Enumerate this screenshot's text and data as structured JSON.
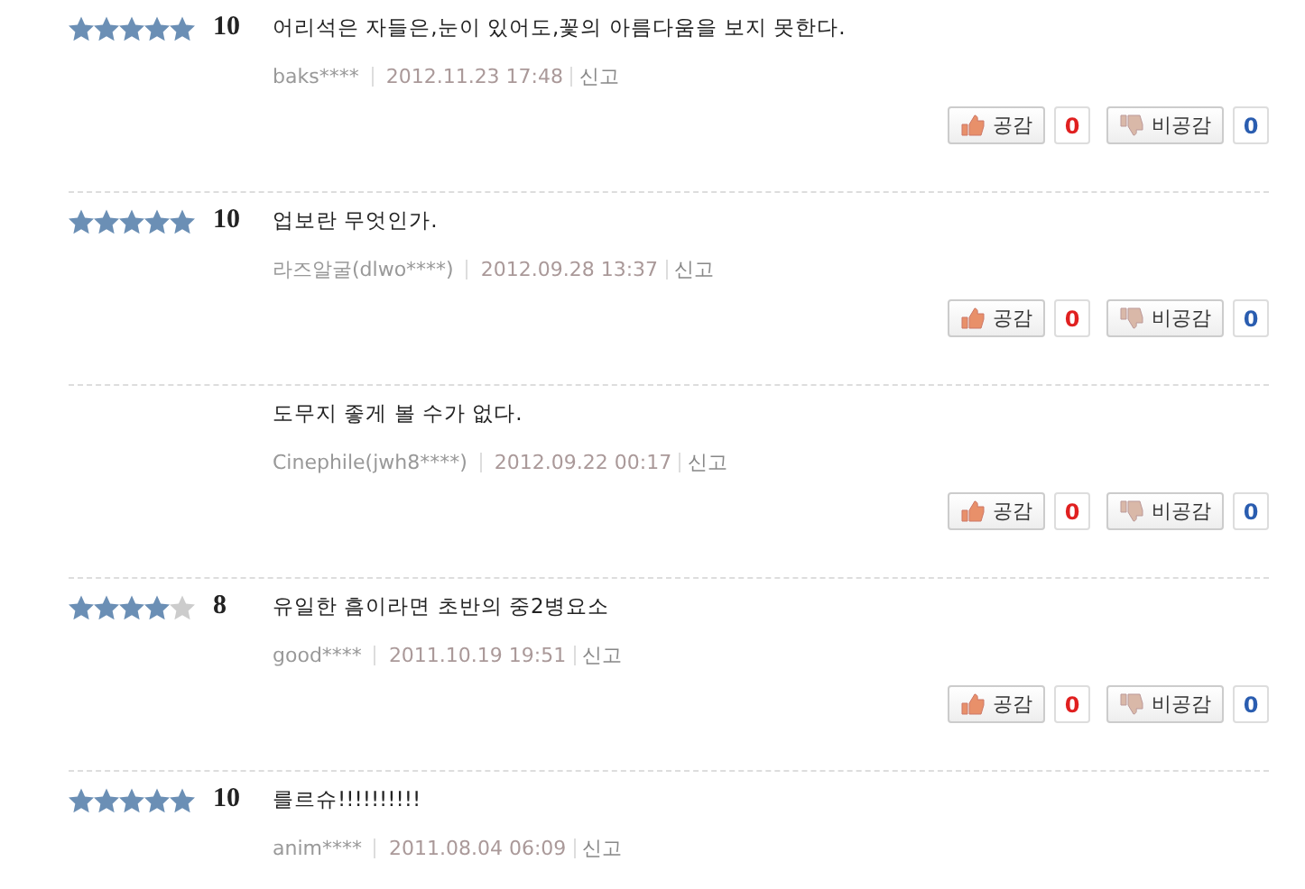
{
  "reviews": [
    {
      "stars": 5,
      "score": "10",
      "text": "어리석은 자들은,눈이 있어도,꽃의 아름다움을 보지 못한다.",
      "user": "baks****",
      "date": "2012.11.23 17:48",
      "report": "신고",
      "agree_label": "공감",
      "agree_count": "0",
      "disagree_label": "비공감",
      "disagree_count": "0"
    },
    {
      "stars": 5,
      "score": "10",
      "text": "업보란 무엇인가.",
      "user": "라즈알굴(dlwo****)",
      "date": "2012.09.28 13:37",
      "report": "신고",
      "agree_label": "공감",
      "agree_count": "0",
      "disagree_label": "비공감",
      "disagree_count": "0"
    },
    {
      "text": "도무지 좋게 볼 수가 없다.",
      "user": "Cinephile(jwh8****)",
      "date": "2012.09.22 00:17",
      "report": "신고",
      "agree_label": "공감",
      "agree_count": "0",
      "disagree_label": "비공감",
      "disagree_count": "0"
    },
    {
      "stars": 4,
      "score": "8",
      "text": "유일한 흠이라면 초반의 중2병요소",
      "user": "good****",
      "date": "2011.10.19 19:51",
      "report": "신고",
      "agree_label": "공감",
      "agree_count": "0",
      "disagree_label": "비공감",
      "disagree_count": "0"
    },
    {
      "stars": 5,
      "score": "10",
      "text": "를르슈!!!!!!!!!!",
      "user": "anim****",
      "date": "2011.08.04 06:09",
      "report": "신고"
    }
  ]
}
